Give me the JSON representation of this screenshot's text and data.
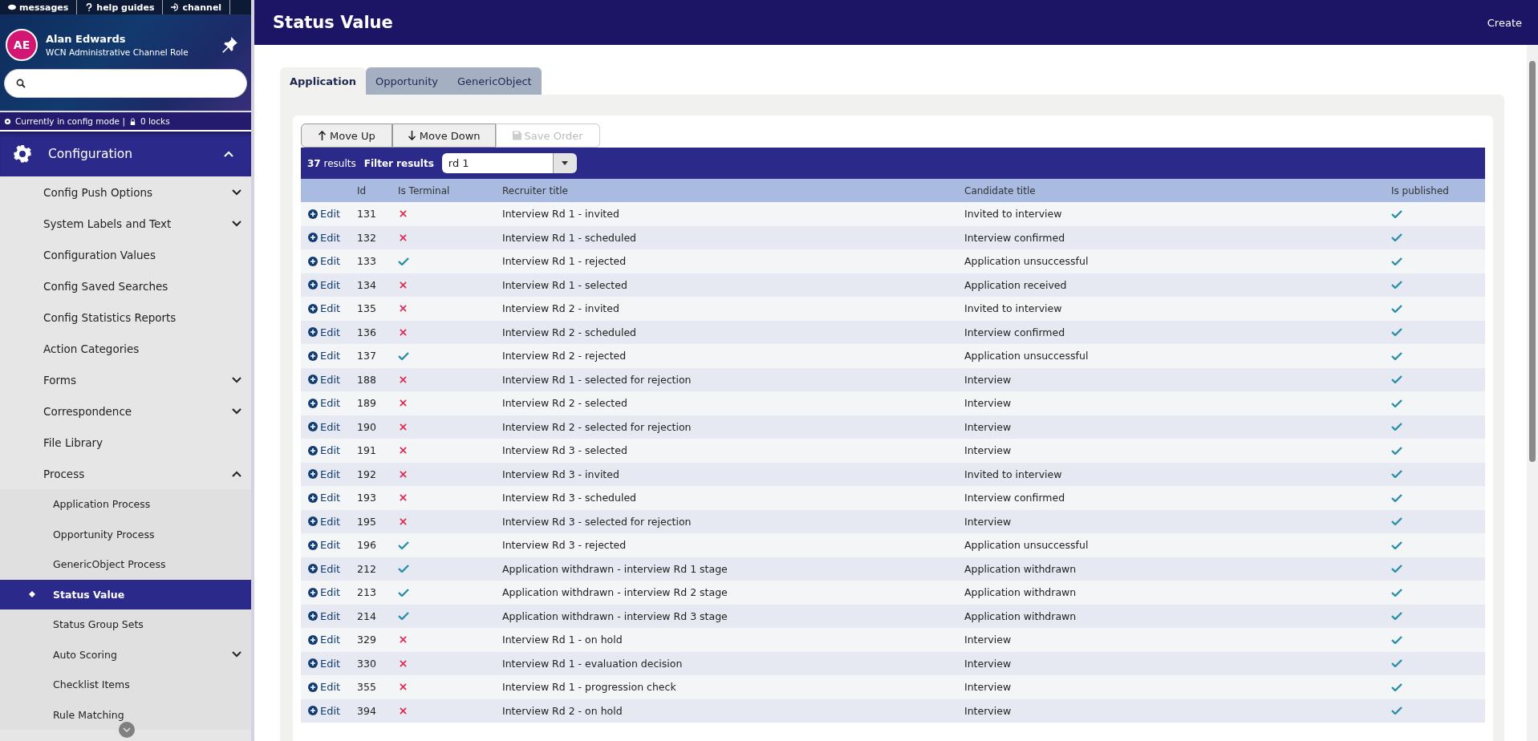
{
  "top_links": [
    {
      "kind": "messages",
      "label": "messages"
    },
    {
      "kind": "help",
      "label": "help guides"
    },
    {
      "kind": "channel",
      "label": "channel"
    }
  ],
  "user": {
    "initials": "AE",
    "name": "Alan Edwards",
    "role": "WCN Administrative Channel Role"
  },
  "mode_bar": {
    "mode": "Currently in config mode |",
    "locks": "0 locks"
  },
  "nav": {
    "title": "Configuration",
    "expanded": true,
    "items": [
      {
        "label": "Config Push Options",
        "expanded": false
      },
      {
        "label": "System Labels and Text",
        "expanded": false
      },
      {
        "label": "Configuration Values"
      },
      {
        "label": "Config Saved Searches"
      },
      {
        "label": "Config Statistics Reports"
      },
      {
        "label": "Action Categories"
      },
      {
        "label": "Forms",
        "expanded": false
      },
      {
        "label": "Correspondence",
        "expanded": false
      },
      {
        "label": "File Library"
      },
      {
        "label": "Process",
        "expanded": true,
        "children": [
          {
            "label": "Application Process",
            "selected": false
          },
          {
            "label": "Opportunity Process",
            "selected": false
          },
          {
            "label": "GenericObject Process",
            "selected": false
          },
          {
            "label": "Status Value",
            "selected": true
          },
          {
            "label": "Status Group Sets",
            "selected": false
          },
          {
            "label": "Auto Scoring",
            "selected": false,
            "expanded": false
          },
          {
            "label": "Checklist Items",
            "selected": false
          },
          {
            "label": "Rule Matching",
            "selected": false
          }
        ]
      }
    ]
  },
  "page": {
    "title": "Status Value",
    "action": "Create"
  },
  "tabs": [
    {
      "label": "Application",
      "selected": true
    },
    {
      "label": "Opportunity",
      "selected": false
    },
    {
      "label": "GenericObject",
      "selected": false
    }
  ],
  "toolbar": [
    {
      "label": "Move Up",
      "kind": "up",
      "disabled": false
    },
    {
      "label": "Move Down",
      "kind": "down",
      "disabled": false
    },
    {
      "label": "Save Order",
      "kind": "save",
      "disabled": true
    }
  ],
  "results": {
    "count": "37",
    "count_label": "results",
    "filter_label": "Filter results",
    "filter_value": "rd 1"
  },
  "table": {
    "columns": [
      "Id",
      "Is Terminal",
      "Recruiter title",
      "Candidate title",
      "Is published"
    ],
    "rows": [
      {
        "edit": "Edit",
        "id": "131",
        "terminal": false,
        "recruiter": "Interview Rd 1 - invited",
        "candidate": "Invited to interview",
        "published": true
      },
      {
        "edit": "Edit",
        "id": "132",
        "terminal": false,
        "recruiter": "Interview Rd 1 - scheduled",
        "candidate": "Interview confirmed",
        "published": true
      },
      {
        "edit": "Edit",
        "id": "133",
        "terminal": true,
        "recruiter": "Interview Rd 1 - rejected",
        "candidate": "Application unsuccessful",
        "published": true
      },
      {
        "edit": "Edit",
        "id": "134",
        "terminal": false,
        "recruiter": "Interview Rd 1 - selected",
        "candidate": "Application received",
        "published": true
      },
      {
        "edit": "Edit",
        "id": "135",
        "terminal": false,
        "recruiter": "Interview Rd 2 - invited",
        "candidate": "Invited to interview",
        "published": true
      },
      {
        "edit": "Edit",
        "id": "136",
        "terminal": false,
        "recruiter": "Interview Rd 2 - scheduled",
        "candidate": "Interview confirmed",
        "published": true
      },
      {
        "edit": "Edit",
        "id": "137",
        "terminal": true,
        "recruiter": "Interview Rd 2 - rejected",
        "candidate": "Application unsuccessful",
        "published": true
      },
      {
        "edit": "Edit",
        "id": "188",
        "terminal": false,
        "recruiter": "Interview Rd 1 - selected for rejection",
        "candidate": "Interview",
        "published": true
      },
      {
        "edit": "Edit",
        "id": "189",
        "terminal": false,
        "recruiter": "Interview Rd 2 - selected",
        "candidate": "Interview",
        "published": true
      },
      {
        "edit": "Edit",
        "id": "190",
        "terminal": false,
        "recruiter": "Interview Rd 2 - selected for rejection",
        "candidate": "Interview",
        "published": true
      },
      {
        "edit": "Edit",
        "id": "191",
        "terminal": false,
        "recruiter": "Interview Rd 3 - selected",
        "candidate": "Interview",
        "published": true
      },
      {
        "edit": "Edit",
        "id": "192",
        "terminal": false,
        "recruiter": "Interview Rd 3 - invited",
        "candidate": "Invited to interview",
        "published": true
      },
      {
        "edit": "Edit",
        "id": "193",
        "terminal": false,
        "recruiter": "Interview Rd 3 - scheduled",
        "candidate": "Interview confirmed",
        "published": true
      },
      {
        "edit": "Edit",
        "id": "195",
        "terminal": false,
        "recruiter": "Interview Rd 3 - selected for rejection",
        "candidate": "Interview",
        "published": true
      },
      {
        "edit": "Edit",
        "id": "196",
        "terminal": true,
        "recruiter": "Interview Rd 3 - rejected",
        "candidate": "Application unsuccessful",
        "published": true
      },
      {
        "edit": "Edit",
        "id": "212",
        "terminal": true,
        "recruiter": "Application withdrawn - interview Rd 1 stage",
        "candidate": "Application withdrawn",
        "published": true
      },
      {
        "edit": "Edit",
        "id": "213",
        "terminal": true,
        "recruiter": "Application withdrawn - interview Rd 2 stage",
        "candidate": "Application withdrawn",
        "published": true
      },
      {
        "edit": "Edit",
        "id": "214",
        "terminal": true,
        "recruiter": "Application withdrawn - interview Rd 3 stage",
        "candidate": "Application withdrawn",
        "published": true
      },
      {
        "edit": "Edit",
        "id": "329",
        "terminal": false,
        "recruiter": "Interview Rd 1 - on hold",
        "candidate": "Interview",
        "published": true
      },
      {
        "edit": "Edit",
        "id": "330",
        "terminal": false,
        "recruiter": "Interview Rd 1 - evaluation decision",
        "candidate": "Interview",
        "published": true
      },
      {
        "edit": "Edit",
        "id": "355",
        "terminal": false,
        "recruiter": "Interview Rd 1 - progression check",
        "candidate": "Interview",
        "published": true
      },
      {
        "edit": "Edit",
        "id": "394",
        "terminal": false,
        "recruiter": "Interview Rd 2 - on hold",
        "candidate": "Interview",
        "published": true
      }
    ]
  }
}
